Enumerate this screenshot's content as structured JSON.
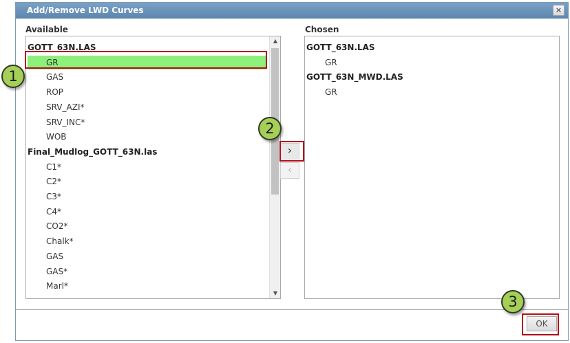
{
  "dialog": {
    "title": "Add/Remove LWD Curves",
    "close_glyph": "×"
  },
  "available": {
    "label": "Available",
    "items": [
      {
        "text": "GOTT_63N.LAS",
        "group": true
      },
      {
        "text": "GR",
        "selected": true
      },
      {
        "text": "GAS"
      },
      {
        "text": "ROP"
      },
      {
        "text": "SRV_AZI*"
      },
      {
        "text": "SRV_INC*"
      },
      {
        "text": "WOB"
      },
      {
        "text": "Final_Mudlog_GOTT_63N.las",
        "group": true
      },
      {
        "text": "C1*"
      },
      {
        "text": "C2*"
      },
      {
        "text": "C3*"
      },
      {
        "text": "C4*"
      },
      {
        "text": "CO2*"
      },
      {
        "text": "Chalk*"
      },
      {
        "text": "GAS"
      },
      {
        "text": "GAS*"
      },
      {
        "text": "Marl*"
      }
    ]
  },
  "chosen": {
    "label": "Chosen",
    "items": [
      {
        "text": "GOTT_63N.LAS",
        "group": true
      },
      {
        "text": "GR"
      },
      {
        "text": "GOTT_63N_MWD.LAS",
        "group": true
      },
      {
        "text": "GR"
      }
    ]
  },
  "buttons": {
    "add_glyph": "›",
    "remove_glyph": "‹",
    "ok_label": "OK"
  },
  "callouts": [
    "1",
    "2",
    "3"
  ],
  "colors": {
    "title_bar": "#6a93ba",
    "selected_row": "#8cf07a",
    "callout_fill": "#a6cf57",
    "highlight_border": "#b10d16"
  }
}
